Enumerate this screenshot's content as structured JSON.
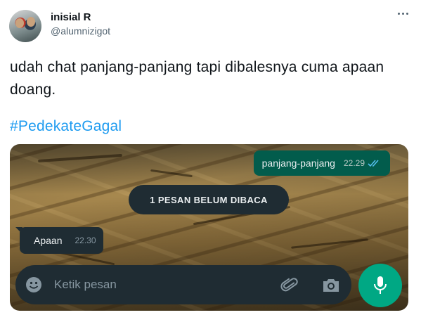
{
  "tweet": {
    "author_name": "inisial R",
    "author_handle": "@alumnizigot",
    "text": "udah chat panjang-panjang tapi dibalesnya cuma apaan doang.",
    "hashtag": "#PedekateGagal"
  },
  "chat": {
    "outgoing": {
      "text": "panjang-panjang",
      "time": "22.29"
    },
    "unread_banner": "1 PESAN BELUM DIBACA",
    "incoming": {
      "text": "Apaan",
      "time": "22.30"
    },
    "input_placeholder": "Ketik pesan"
  },
  "icons": {
    "more": "more-horizontal-icon",
    "emoji": "emoji-icon",
    "attach": "paperclip-icon",
    "camera": "camera-icon",
    "mic": "microphone-icon",
    "read_ticks": "double-check-icon"
  },
  "colors": {
    "hashtag": "#1d9bf0",
    "outgoing_bubble": "#025c4c",
    "incoming_bubble": "#1f2c33",
    "mic_button": "#00a884",
    "read_ticks": "#53bdeb"
  }
}
